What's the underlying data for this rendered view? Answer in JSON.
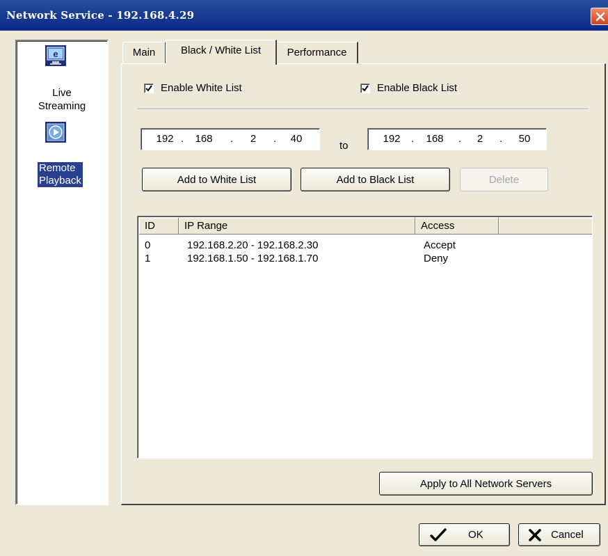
{
  "window": {
    "title": "Network Service - 192.168.4.29"
  },
  "sidebar": {
    "items": [
      {
        "label_line1": "Live",
        "label_line2": "Streaming",
        "icon": "live-streaming-icon",
        "selected": false
      },
      {
        "label_line1": "Remote",
        "label_line2": "Playback",
        "icon": "remote-playback-icon",
        "selected": true
      }
    ]
  },
  "tabs": [
    {
      "label": "Main",
      "active": false
    },
    {
      "label": "Black / White List",
      "active": true
    },
    {
      "label": "Performance",
      "active": false
    }
  ],
  "options": {
    "enable_white_list": {
      "label": "Enable White List",
      "checked": true
    },
    "enable_black_list": {
      "label": "Enable Black List",
      "checked": true
    }
  },
  "ip_range": {
    "from": {
      "o1": "192",
      "o2": "168",
      "o3": "2",
      "o4": "40"
    },
    "to_label": "to",
    "to": {
      "o1": "192",
      "o2": "168",
      "o3": "2",
      "o4": "50"
    },
    "separator": "."
  },
  "buttons": {
    "add_white": "Add to White List",
    "add_black": "Add to Black List",
    "delete": "Delete",
    "apply_all": "Apply to All Network Servers",
    "ok": "OK",
    "cancel": "Cancel"
  },
  "list": {
    "columns": [
      "ID",
      "IP Range",
      "Access"
    ],
    "rows": [
      {
        "id": "0",
        "ip_range": "192.168.2.20 - 192.168.2.30",
        "access": "Accept"
      },
      {
        "id": "1",
        "ip_range": "192.168.1.50 - 192.168.1.70",
        "access": "Deny"
      }
    ]
  },
  "colors": {
    "titlebar": "#1c3f94",
    "dialog_bg": "#ece9d8",
    "selection": "#2a3f8f",
    "close_button": "#d4421e"
  }
}
